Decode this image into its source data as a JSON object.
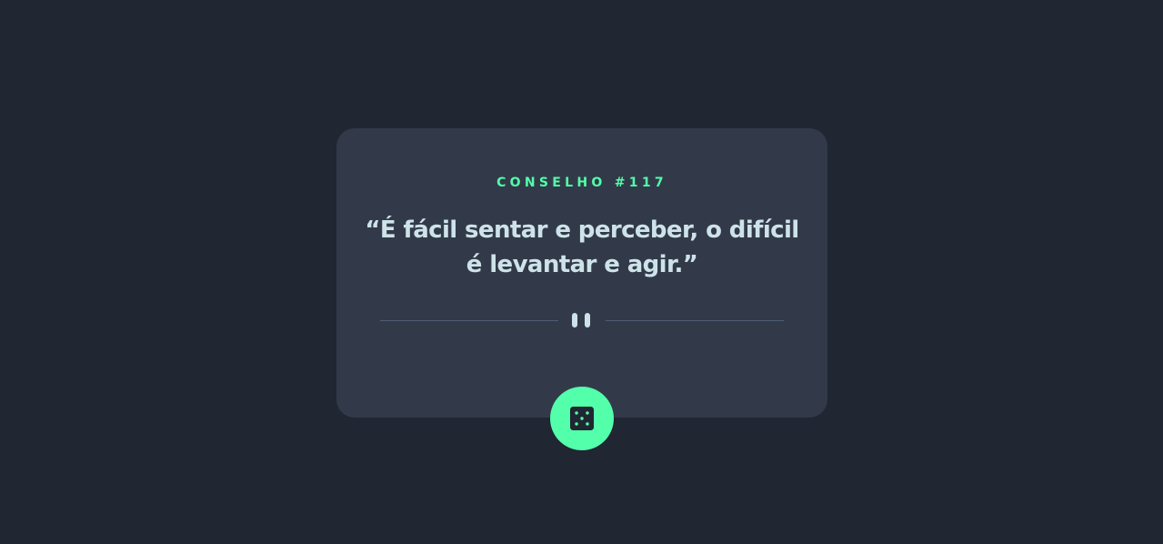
{
  "card": {
    "advice_id_label": "CONSELHO #117",
    "quote": "“É fácil sentar e perceber, o difícil é levantar e agir.”"
  },
  "divider": {
    "icon": "pause-icon"
  },
  "dice_button": {
    "icon": "dice-icon"
  },
  "colors": {
    "background": "#202632",
    "card": "#323a49",
    "accent": "#53ffaa",
    "text": "#cee3e9",
    "divider": "#4f5d74"
  }
}
